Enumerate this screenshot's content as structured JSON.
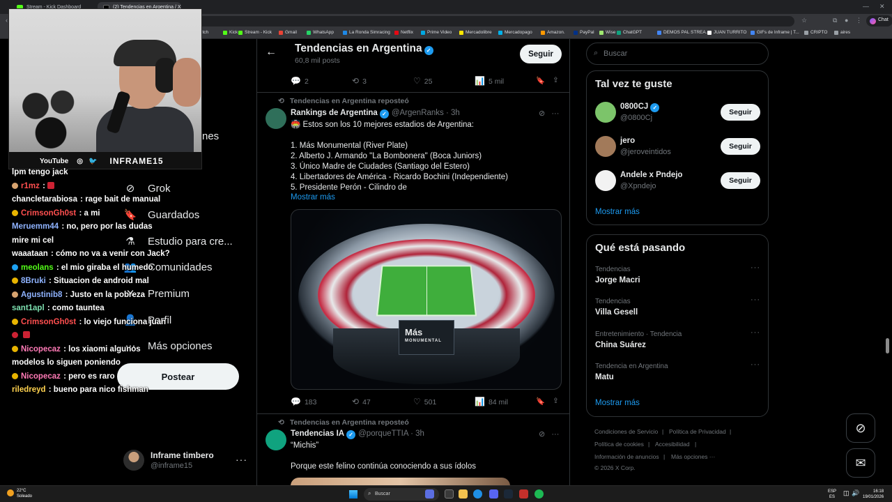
{
  "browser": {
    "tabs": [
      {
        "label": "Stream - Kick Dashboard",
        "color": "#53fc18",
        "active": false
      },
      {
        "label": "(2) Tendencias en Argentina / X",
        "color": "#000000",
        "active": true
      }
    ],
    "chat_label": "Chat",
    "bookmarks": [
      {
        "label": "itch",
        "color": "#9146ff"
      },
      {
        "label": "Kick",
        "color": "#53fc18"
      },
      {
        "label": "Stream - Kick",
        "color": "#53fc18"
      },
      {
        "label": "Gmail",
        "color": "#ea4335"
      },
      {
        "label": "WhatsApp",
        "color": "#25d366"
      },
      {
        "label": "La Ronda Simracing",
        "color": "#1e88e5"
      },
      {
        "label": "Netflix",
        "color": "#e50914"
      },
      {
        "label": "Prime Video",
        "color": "#00a8e1"
      },
      {
        "label": "Mercadolibre",
        "color": "#ffe600"
      },
      {
        "label": "Mercadopago",
        "color": "#00b1ea"
      },
      {
        "label": "Amazon.",
        "color": "#ff9900"
      },
      {
        "label": "PayPal",
        "color": "#003087"
      },
      {
        "label": "Wise",
        "color": "#9fe870"
      },
      {
        "label": "ChatGPT",
        "color": "#10a37f"
      },
      {
        "label": "DEMOS PAL STREA...",
        "color": "#4285f4"
      },
      {
        "label": "JUAN TURRITO",
        "color": "#ffffff"
      },
      {
        "label": "GIFs de Inframe | T...",
        "color": "#4285f4"
      },
      {
        "label": "CRIPTO",
        "color": "#9aa0a6"
      },
      {
        "label": "aires",
        "color": "#9aa0a6"
      }
    ]
  },
  "webcam": {
    "label_youtube": "YouTube",
    "brand": "INFRAME15"
  },
  "nav": {
    "items": [
      {
        "label": "Grok",
        "icon": "grok-icon"
      },
      {
        "label": "Guardados",
        "icon": "bookmark-icon"
      },
      {
        "label": "Estudio para cre...",
        "icon": "flask-icon"
      },
      {
        "label": "Comunidades",
        "icon": "communities-icon"
      },
      {
        "label": "Premium",
        "icon": "x-premium-icon"
      },
      {
        "label": "Perfil",
        "icon": "profile-icon"
      },
      {
        "label": "Más opciones",
        "icon": "more-options-icon"
      }
    ],
    "partial_label": "nes",
    "post_button": "Postear",
    "account_name": "Inframe timbero",
    "account_handle": "@inframe15",
    "account_more": "···"
  },
  "chat": [
    {
      "user": "",
      "message": "lpm tengo jack",
      "color": "#ffffff",
      "badge": ""
    },
    {
      "user": "r1mz",
      "message": ":",
      "color": "#ff4f4f",
      "badge": "#d7a36f",
      "emote": true
    },
    {
      "user": "chancletarabiosa",
      "message": ": rage bait de manual",
      "color": "#ffffff",
      "badge": ""
    },
    {
      "user": "CrimsonGh0st",
      "message": ": a mi",
      "color": "#ff4f4f",
      "badge": "#e8b400"
    },
    {
      "user": "Meruemm44",
      "message": ": no, pero por las dudas",
      "color": "#8fb3ff",
      "badge": ""
    },
    {
      "user": "",
      "message": "mire mi cel",
      "color": "#ffffff",
      "badge": ""
    },
    {
      "user": "waaataan",
      "message": ": cómo no va a venir con Jack?",
      "color": "#ffffff",
      "badge": ""
    },
    {
      "user": "meolans",
      "message": ": el mio giraba el humedo",
      "color": "#53fc18",
      "badge": "#1da1f2"
    },
    {
      "user": "8Bruki",
      "message": ": Situacion de android mal",
      "color": "#8fb3ff",
      "badge": "#e8b400"
    },
    {
      "user": "Agustinib8",
      "message": ": Justo en la pobreza",
      "color": "#8fb3ff",
      "badge": "#d7a36f"
    },
    {
      "user": "sant1apl",
      "message": ": como tauntea",
      "color": "#7de0b0",
      "badge": ""
    },
    {
      "user": "CrimsonGh0st",
      "message": ": lo viejo funciona juan",
      "color": "#ff4f4f",
      "badge": "#e8b400"
    },
    {
      "user": "",
      "message": "",
      "color": "#ffffff",
      "badge": "#c23",
      "emote": true
    },
    {
      "user": "Nicopecaz",
      "message": ": los xiaomi algunos",
      "color": "#ff7ab6",
      "badge": "#e8b400"
    },
    {
      "user": "",
      "message": "modelos lo siguen poniendo",
      "color": "#ffffff",
      "badge": ""
    },
    {
      "user": "Nicopecaz",
      "message": ": pero es raro",
      "color": "#ff7ab6",
      "badge": "#e8b400"
    },
    {
      "user": "riledreyd",
      "message": ": bueno para nico fishman",
      "color": "#ffd24f",
      "badge": ""
    }
  ],
  "header": {
    "title": "Tendencias en Argentina",
    "subtitle": "60,8 mil posts",
    "follow": "Seguir"
  },
  "top_actions": {
    "replies": "2",
    "reposts": "3",
    "likes": "25",
    "views": "5 mil"
  },
  "tweet1": {
    "repost_label": "Tendencias en Argentina reposteó",
    "name": "Rankings de Argentina",
    "handle": "@ArgenRanks · 3h",
    "lines": [
      "🏟️ Estos son los 10 mejores estadios de Argentina:",
      "",
      "1. Más Monumental (River Plate)",
      "2. Alberto J. Armando \"La Bombonera\" (Boca Juniors)",
      "3. Único Madre de Ciudades (Santiago del Estero)",
      "4. Libertadores de América - Ricardo Bochini (Independiente)",
      "5. Presidente Perón - Cilindro de"
    ],
    "show_more": "Mostrar más",
    "image_sign": "Más",
    "image_sign_sub": "MONUMENTAL",
    "replies": "183",
    "reposts": "47",
    "likes": "501",
    "views": "84 mil"
  },
  "tweet2": {
    "repost_label": "Tendencias en Argentina reposteó",
    "name": "Tendencias IA",
    "handle": "@porqueTTIA · 3h",
    "lines": [
      "“Michis”",
      "",
      "Porque este felino continúa conociendo a sus ídolos"
    ]
  },
  "search": {
    "placeholder": "Buscar"
  },
  "suggestions": {
    "title": "Tal vez te guste",
    "items": [
      {
        "name": "0800CJ",
        "handle": "@0800Cj",
        "verified": true,
        "button": "Seguir",
        "avatar_color": "#7cc46a"
      },
      {
        "name": "jero",
        "handle": "@jeroveintidos",
        "verified": false,
        "button": "Seguir",
        "avatar_color": "#a27a5a"
      },
      {
        "name": "Andele x Pndejo",
        "handle": "@Xpndejo",
        "verified": false,
        "button": "Seguir",
        "avatar_color": "#f2f2f2"
      }
    ],
    "more": "Mostrar más"
  },
  "trends": {
    "title": "Qué está pasando",
    "items": [
      {
        "category": "Tendencias",
        "name": "Jorge Macri"
      },
      {
        "category": "Tendencias",
        "name": "Villa Gesell"
      },
      {
        "category": "Entretenimiento · Tendencia",
        "name": "China Suárez"
      },
      {
        "category": "Tendencia en Argentina",
        "name": "Matu"
      }
    ],
    "more": "Mostrar más"
  },
  "footer": {
    "links": [
      "Condiciones de Servicio",
      "|",
      "Política de Privacidad",
      "|",
      "Política de cookies",
      "|",
      "Accesibilidad",
      "|",
      "Información de anuncios",
      "|",
      "Más opciones ···",
      "© 2026 X Corp."
    ]
  },
  "taskbar": {
    "temp": "22°C",
    "weather": "Soleado",
    "search": "Buscar",
    "lang_top": "ESP",
    "lang_bottom": "ES",
    "time": "16:18",
    "date": "19/01/2026"
  }
}
